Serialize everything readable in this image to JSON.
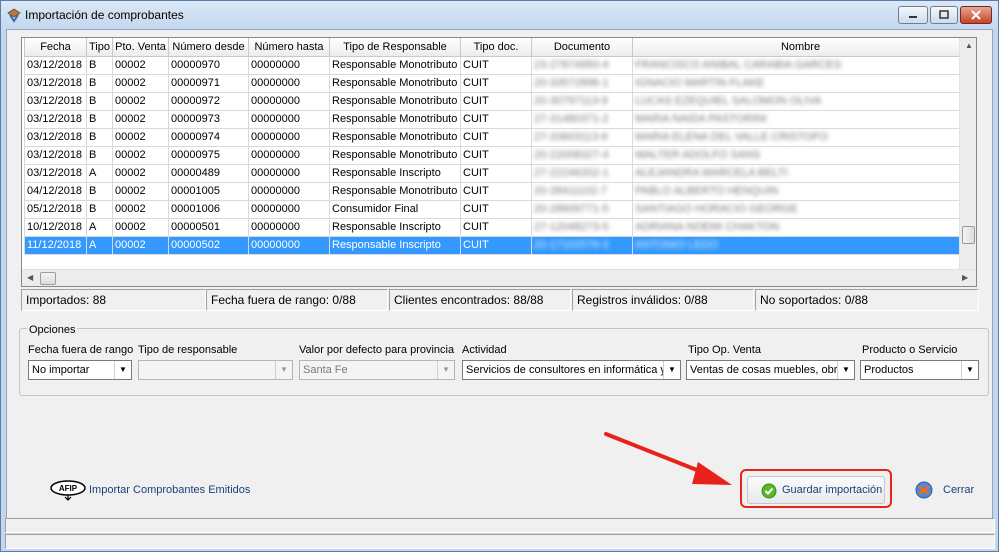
{
  "window": {
    "title": "Importación de comprobantes"
  },
  "grid": {
    "columns": [
      "Fecha",
      "Tipo",
      "Pto. Venta",
      "Número desde",
      "Número hasta",
      "Tipo de Responsable",
      "Tipo doc.",
      "Documento",
      "Nombre"
    ],
    "rows": [
      {
        "fecha": "03/12/2018",
        "tipo": "B",
        "pto": "00002",
        "desde": "00000970",
        "hasta": "00000000",
        "responsable": "Responsable Monotributo",
        "tipo_doc": "CUIT",
        "documento": "23-27874950-4",
        "nombre": "FRANCISCO ANIBAL CARABIA GARCES"
      },
      {
        "fecha": "03/12/2018",
        "tipo": "B",
        "pto": "00002",
        "desde": "00000971",
        "hasta": "00000000",
        "responsable": "Responsable Monotributo",
        "tipo_doc": "CUIT",
        "documento": "20-33572896-1",
        "nombre": "IGNACIO MARTIN FLAKE"
      },
      {
        "fecha": "03/12/2018",
        "tipo": "B",
        "pto": "00002",
        "desde": "00000972",
        "hasta": "00000000",
        "responsable": "Responsable Monotributo",
        "tipo_doc": "CUIT",
        "documento": "20-30797113-9",
        "nombre": "LUCAS EZEQUIEL SALOMON OLIVA"
      },
      {
        "fecha": "03/12/2018",
        "tipo": "B",
        "pto": "00002",
        "desde": "00000973",
        "hasta": "00000000",
        "responsable": "Responsable Monotributo",
        "tipo_doc": "CUIT",
        "documento": "27-31480371-2",
        "nombre": "MARIA NAIDA PASTORINI"
      },
      {
        "fecha": "03/12/2018",
        "tipo": "B",
        "pto": "00002",
        "desde": "00000974",
        "hasta": "00000000",
        "responsable": "Responsable Monotributo",
        "tipo_doc": "CUIT",
        "documento": "27-20603113-6",
        "nombre": "MARIA ELENA DEL VALLE CRISTOFO"
      },
      {
        "fecha": "03/12/2018",
        "tipo": "B",
        "pto": "00002",
        "desde": "00000975",
        "hasta": "00000000",
        "responsable": "Responsable Monotributo",
        "tipo_doc": "CUIT",
        "documento": "20-22008327-4",
        "nombre": "WALTER ADOLFO SANS"
      },
      {
        "fecha": "03/12/2018",
        "tipo": "A",
        "pto": "00002",
        "desde": "00000489",
        "hasta": "00000000",
        "responsable": "Responsable Inscripto",
        "tipo_doc": "CUIT",
        "documento": "27-22246202-1",
        "nombre": "ALEJANDRA MARCELA BELTI"
      },
      {
        "fecha": "04/12/2018",
        "tipo": "B",
        "pto": "00002",
        "desde": "00001005",
        "hasta": "00000000",
        "responsable": "Responsable Monotributo",
        "tipo_doc": "CUIT",
        "documento": "20-28411102-7",
        "nombre": "PABLO ALBERTO HENQUIN"
      },
      {
        "fecha": "05/12/2018",
        "tipo": "B",
        "pto": "00002",
        "desde": "00001006",
        "hasta": "00000000",
        "responsable": "Consumidor Final",
        "tipo_doc": "CUIT",
        "documento": "20-28609771-5",
        "nombre": "SANTIAGO HORACIO GEORGE"
      },
      {
        "fecha": "10/12/2018",
        "tipo": "A",
        "pto": "00002",
        "desde": "00000501",
        "hasta": "00000000",
        "responsable": "Responsable Inscripto",
        "tipo_doc": "CUIT",
        "documento": "27-12048273-5",
        "nombre": "ADRIANA NOEMI CHAKTON"
      },
      {
        "fecha": "11/12/2018",
        "tipo": "A",
        "pto": "00002",
        "desde": "00000502",
        "hasta": "00000000",
        "responsable": "Responsable Inscripto",
        "tipo_doc": "CUIT",
        "documento": "20-17102576-3",
        "nombre": "ANTONIO LEDO",
        "selected": true
      }
    ]
  },
  "status": {
    "importados": "Importados: 88",
    "fecha_fuera": "Fecha fuera de rango: 0/88",
    "clientes": "Clientes encontrados: 88/88",
    "registros": "Registros inválidos: 0/88",
    "no_soportados": "No soportados: 0/88"
  },
  "options": {
    "legend": "Opciones",
    "fecha_fuera_label": "Fecha fuera de rango",
    "fecha_fuera_value": "No importar",
    "tipo_responsable_label": "Tipo de responsable",
    "tipo_responsable_value": "",
    "provincia_label": "Valor por defecto para provincia",
    "provincia_value": "Santa Fe",
    "actividad_label": "Actividad",
    "actividad_value": "Servicios de consultores en informática y",
    "tipo_op_label": "Tipo Op. Venta",
    "tipo_op_value": "Ventas de cosas muebles, obra",
    "producto_label": "Producto o Servicio",
    "producto_value": "Productos"
  },
  "actions": {
    "afip_icon_text": "AFIP",
    "importar_emitidos": "Importar Comprobantes Emitidos",
    "guardar": "Guardar importación",
    "cerrar": "Cerrar"
  },
  "colors": {
    "selection": "#3399ff",
    "highlight": "#e8221b",
    "link": "#1a3f7a"
  }
}
